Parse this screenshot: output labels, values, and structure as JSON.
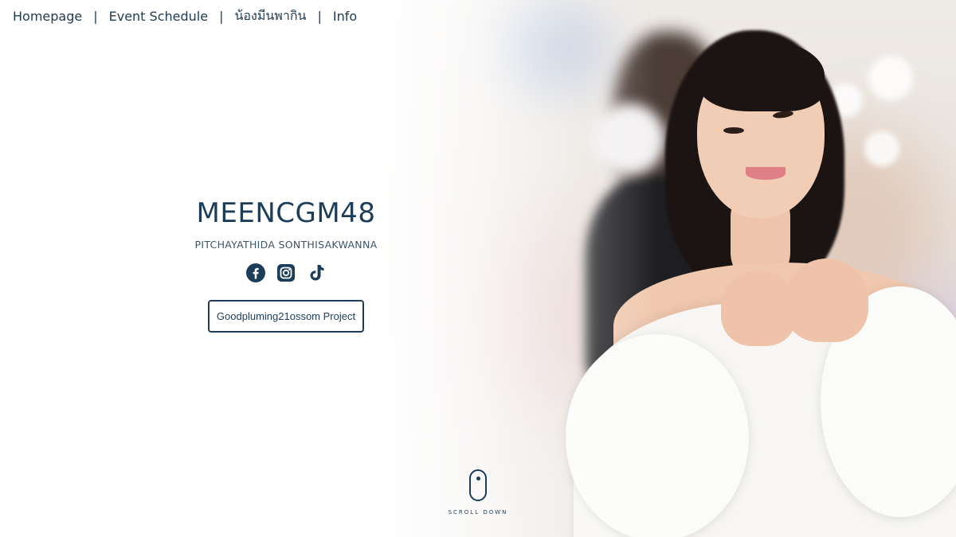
{
  "nav": {
    "items": [
      {
        "label": "Homepage"
      },
      {
        "label": "Event Schedule"
      },
      {
        "label": "น้องมีนพากิน"
      },
      {
        "label": "Info"
      }
    ],
    "separator": "|"
  },
  "intro": {
    "name": "MEENCGM48",
    "full_name": "PITCHAYATHIDA SONTHISAKWANNA",
    "socials": [
      "facebook-icon",
      "instagram-icon",
      "tiktok-icon"
    ],
    "project_button": "Goodpluming21ossom Project"
  },
  "scroll": {
    "label": "SCROLL DOWN"
  },
  "colors": {
    "primary": "#1b3d5a",
    "background": "#ffffff"
  }
}
